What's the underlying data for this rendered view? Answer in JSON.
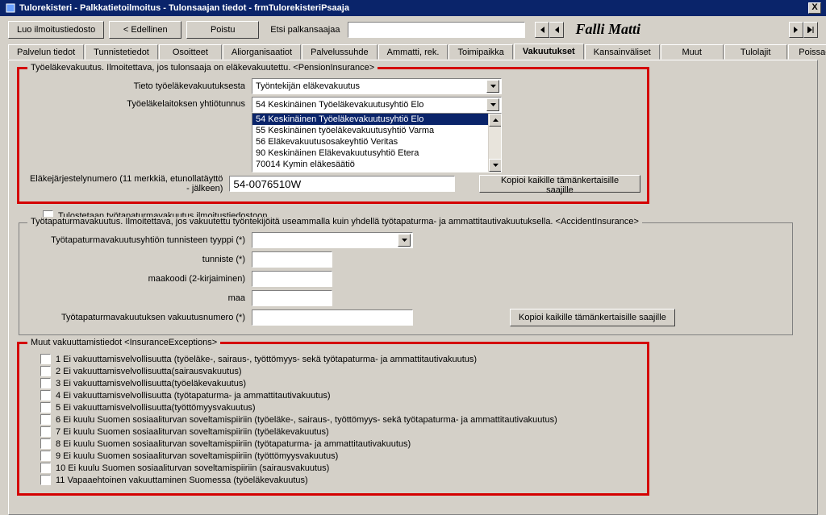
{
  "window": {
    "title": "Tulorekisteri - Palkkatietoilmoitus - Tulonsaajan tiedot - frmTulorekisteriPsaaja",
    "close": "X"
  },
  "toolbar": {
    "create": "Luo ilmoitustiedosto",
    "prev": "< Edellinen",
    "exit": "Poistu",
    "searchlbl": "Etsi palkansaajaa",
    "search_value": "",
    "person": "Falli Matti"
  },
  "tabs": [
    {
      "label": "Palvelun tiedot"
    },
    {
      "label": "Tunnistetiedot"
    },
    {
      "label": "Osoitteet"
    },
    {
      "label": "Aliorganisaatiot"
    },
    {
      "label": "Palvelussuhde"
    },
    {
      "label": "Ammatti, rek."
    },
    {
      "label": "Toimipaikka"
    },
    {
      "label": "Vakuutukset"
    },
    {
      "label": "Kansainväliset"
    },
    {
      "label": "Muut"
    },
    {
      "label": "Tulolajit"
    },
    {
      "label": "Poissaolot"
    }
  ],
  "pension": {
    "legend": "Työeläkevakuutus. Ilmoitettava, jos tulonsaaja on eläkevakuutettu. <PensionInsurance>",
    "field1_label": "Tieto työeläkevakuutuksesta",
    "field1_value": "Työntekijän eläkevakuutus",
    "field2_label": "Työeläkelaitoksen yhtiötunnus",
    "field2_value": "54 Keskinäinen Työeläkevakuutusyhtiö Elo",
    "options": [
      "54 Keskinäinen Työeläkevakuutusyhtiö Elo",
      "55 Keskinäinen työeläkevakuutusyhtiö Varma",
      "56 Eläkevakuutusosakeyhtiö Veritas",
      "90 Keskinäinen Eläkevakuutusyhtiö Etera",
      "70014 Kymin eläkesäätiö"
    ],
    "field3_label": "Eläkejärjestelynumero (11 merkkiä, etunollatäyttö - jälkeen)",
    "field3_value": "54-0076510W",
    "copy_btn": "Kopioi kaikille tämänkertaisille saajille"
  },
  "accident": {
    "print_chk": "Tulostetaan työtapaturmavakuutus ilmoitustiedostoon",
    "legend": "Työtapaturmavakuutus. Ilmoitettava, jos vakuutettu työntekijöitä useammalla kuin yhdellä työtapaturma- ja ammattitautivakuutuksella.  <AccidentInsurance>",
    "f1": "Työtapaturmavakuutusyhtiön tunnisteen tyyppi (*)",
    "f1v": "",
    "f2": "tunniste (*)",
    "f2v": "",
    "f3": "maakoodi (2-kirjaiminen)",
    "f3v": "",
    "f4": "maa",
    "f4v": "",
    "f5": "Työtapaturmavakuutuksen vakuutusnumero (*)",
    "f5v": "",
    "copy_btn": "Kopioi kaikille tämänkertaisille saajille"
  },
  "exceptions": {
    "legend": "Muut vakuuttamistiedot  <InsuranceExceptions>",
    "items": [
      "1 Ei vakuuttamisvelvollisuutta (työeläke-, sairaus-, työttömyys- sekä työtapaturma- ja ammattitautivakuutus)",
      "2 Ei vakuuttamisvelvollisuutta(sairausvakuutus)",
      "3 Ei vakuuttamisvelvollisuutta(työeläkevakuutus)",
      "4 Ei vakuuttamisvelvollisuutta (työtapaturma- ja ammattitautivakuutus)",
      "5 Ei vakuuttamisvelvollisuutta(työttömyysvakuutus)",
      "6 Ei kuulu Suomen sosiaaliturvan soveltamispiiriin (työeläke-, sairaus-, työttömyys- sekä työtapaturma- ja ammattitautivakuutus)",
      "7 Ei kuulu Suomen sosiaaliturvan soveltamispiiriin (työeläkevakuutus)",
      "8 Ei kuulu Suomen sosiaaliturvan soveltamispiiriin (työtapaturma- ja ammattitautivakuutus)",
      "9 Ei kuulu Suomen sosiaaliturvan soveltamispiiriin (työttömyysvakuutus)",
      "10 Ei kuulu Suomen sosiaaliturvan soveltamispiiriin (sairausvakuutus)",
      "11 Vapaaehtoinen vakuuttaminen Suomessa (työeläkevakuutus)"
    ]
  }
}
